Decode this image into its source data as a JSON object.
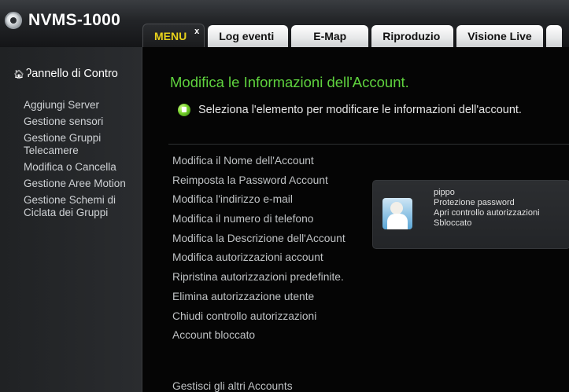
{
  "app": {
    "title": "NVMS-1000"
  },
  "tabs": [
    {
      "label": "MENU",
      "close": "x"
    },
    {
      "label": "Log eventi"
    },
    {
      "label": "E-Map"
    },
    {
      "label": "Riproduzio"
    },
    {
      "label": "Visione Live"
    }
  ],
  "sidebar": {
    "header": "Pannello di Controllo",
    "header_visible": "ʔannello di Contro",
    "items": [
      {
        "label": "Aggiungi Server"
      },
      {
        "label": "Gestione sensori"
      },
      {
        "label": "Gestione Gruppi Telecamere"
      },
      {
        "label": "Modifica o Cancella"
      },
      {
        "label": "Gestione Aree Motion"
      },
      {
        "label": "Gestione Schemi di Ciclata dei Gruppi"
      }
    ]
  },
  "main": {
    "title": "Modifica le Informazioni dell'Account.",
    "subtitle": "Seleziona l'elemento per modificare le informazioni dell'account.",
    "options": [
      "Modifica il Nome dell'Account",
      "Reimposta la Password Account",
      "Modifica l'indirizzo e-mail",
      "Modifica il numero di telefono",
      "Modifica la Descrizione dell'Account",
      "Modifica autorizzazioni account",
      "Ripristina autorizzazioni predefinite.",
      "Elimina autorizzazione utente",
      "Chiudi controllo autorizzazioni",
      "Account bloccato"
    ],
    "manage_link": "Gestisci gli altri Accounts"
  },
  "user_card": {
    "name": "pippo",
    "line1": "Protezione password",
    "line2": "Apri controllo autorizzazioni",
    "line3": "Sbloccato",
    "icon": "user-avatar-icon"
  },
  "colors": {
    "accent_green": "#5fd23e",
    "active_tab_text": "#e8d21b",
    "background": "#050505"
  }
}
